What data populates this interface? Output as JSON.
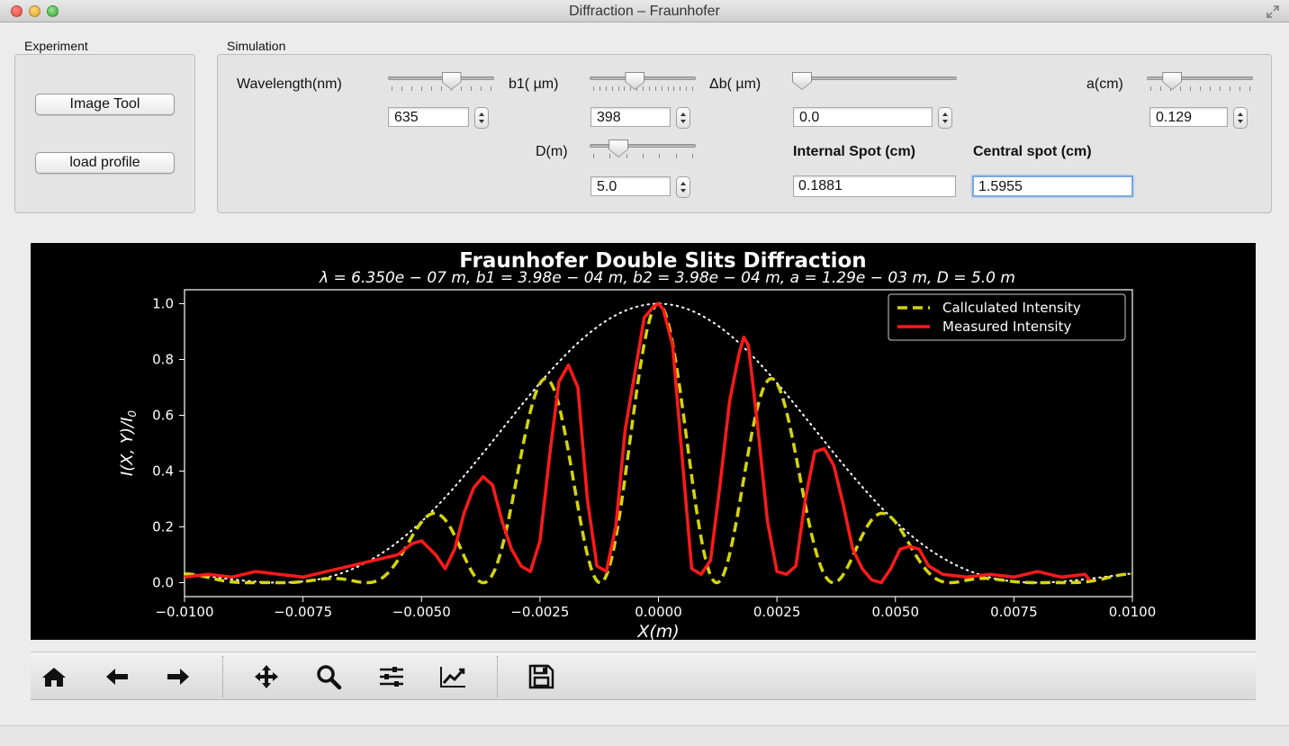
{
  "window": {
    "title": "Diffraction – Fraunhofer"
  },
  "experiment": {
    "group_label": "Experiment",
    "image_tool_label": "Image Tool",
    "load_profile_label": "load profile"
  },
  "simulation": {
    "group_label": "Simulation",
    "wavelength": {
      "label": "Wavelength(nm)",
      "value": "635"
    },
    "b1": {
      "label": "b1( µm)",
      "value": "398"
    },
    "delta_b": {
      "label": "Δb( µm)",
      "value": "0.0"
    },
    "a": {
      "label": "a(cm)",
      "value": "0.129"
    },
    "D": {
      "label": "D(m)",
      "value": "5.0"
    },
    "internal_spot": {
      "label": "Internal Spot (cm)",
      "value": "0.1881"
    },
    "central_spot": {
      "label": "Central spot (cm)",
      "value": "1.5955"
    }
  },
  "chart_data": {
    "type": "line",
    "title": "Fraunhofer Double Slits Diffraction",
    "subtitle": "λ = 6.350e − 07 m,  b1 = 3.98e − 04 m,  b2 = 3.98e − 04 m,  a = 1.29e − 03 m,  D = 5.0 m",
    "xlabel": "X(m)",
    "ylabel": "I(X, Y)/I",
    "ylabel_subscript": "0",
    "xlim": [
      -0.01,
      0.01
    ],
    "ylim": [
      -0.05,
      1.05
    ],
    "x_ticks": [
      "−0.0100",
      "−0.0075",
      "−0.0050",
      "−0.0025",
      "0.0000",
      "0.0025",
      "0.0050",
      "0.0075",
      "0.0100"
    ],
    "x_tick_values": [
      -0.01,
      -0.0075,
      -0.005,
      -0.0025,
      0,
      0.0025,
      0.005,
      0.0075,
      0.01
    ],
    "y_ticks": [
      "0.0",
      "0.2",
      "0.4",
      "0.6",
      "0.8",
      "1.0"
    ],
    "y_tick_values": [
      0,
      0.2,
      0.4,
      0.6,
      0.8,
      1.0
    ],
    "grid": false,
    "legend_position": "top-right",
    "background": "#000000",
    "parameters": {
      "wavelength_m": 6.35e-07,
      "b1_m": 0.000398,
      "b2_m": 0.000398,
      "a_m": 0.00129,
      "D_m": 5.0
    },
    "series": [
      {
        "name": "Callculated Intensity",
        "style": "dashed",
        "color": "#d4d40f",
        "model": "double-slit"
      },
      {
        "name": "Measured Intensity",
        "style": "solid",
        "color": "#ff1a1a",
        "x": [
          -0.01,
          -0.0095,
          -0.009,
          -0.0085,
          -0.008,
          -0.0075,
          -0.007,
          -0.0065,
          -0.006,
          -0.0055,
          -0.0052,
          -0.005,
          -0.0047,
          -0.0045,
          -0.0043,
          -0.0041,
          -0.0039,
          -0.0037,
          -0.0035,
          -0.0033,
          -0.0031,
          -0.0029,
          -0.0027,
          -0.0025,
          -0.0023,
          -0.0021,
          -0.0019,
          -0.0017,
          -0.0015,
          -0.0013,
          -0.0011,
          -0.0009,
          -0.0007,
          -0.0005,
          -0.0003,
          -0.0001,
          0.0,
          0.0001,
          0.0003,
          0.0005,
          0.0007,
          0.0009,
          0.0011,
          0.0013,
          0.0015,
          0.0017,
          0.0018,
          0.0019,
          0.0021,
          0.0023,
          0.0025,
          0.0027,
          0.0029,
          0.0031,
          0.0033,
          0.0035,
          0.0037,
          0.0039,
          0.0041,
          0.0043,
          0.0045,
          0.0047,
          0.0049,
          0.0051,
          0.0053,
          0.0055,
          0.0057,
          0.006,
          0.0065,
          0.007,
          0.0075,
          0.008,
          0.0085,
          0.009,
          0.0091
        ],
        "y": [
          0.02,
          0.03,
          0.02,
          0.04,
          0.03,
          0.02,
          0.04,
          0.06,
          0.08,
          0.1,
          0.14,
          0.15,
          0.1,
          0.05,
          0.12,
          0.25,
          0.34,
          0.38,
          0.35,
          0.22,
          0.12,
          0.06,
          0.04,
          0.15,
          0.45,
          0.72,
          0.78,
          0.7,
          0.3,
          0.06,
          0.04,
          0.2,
          0.55,
          0.75,
          0.95,
          0.99,
          1.0,
          0.98,
          0.85,
          0.45,
          0.05,
          0.03,
          0.08,
          0.35,
          0.65,
          0.82,
          0.88,
          0.85,
          0.55,
          0.22,
          0.04,
          0.03,
          0.06,
          0.3,
          0.47,
          0.48,
          0.42,
          0.28,
          0.12,
          0.05,
          0.01,
          0.0,
          0.05,
          0.12,
          0.13,
          0.12,
          0.06,
          0.03,
          0.02,
          0.03,
          0.02,
          0.04,
          0.02,
          0.03,
          0.01
        ]
      },
      {
        "name": "",
        "style": "dotted",
        "color": "#ffffff",
        "model": "envelope"
      }
    ]
  },
  "toolbar": {
    "icons": [
      "home-icon",
      "back-arrow-icon",
      "forward-arrow-icon",
      "pan-icon",
      "zoom-icon",
      "subplots-icon",
      "edit-curves-icon",
      "save-icon"
    ]
  }
}
